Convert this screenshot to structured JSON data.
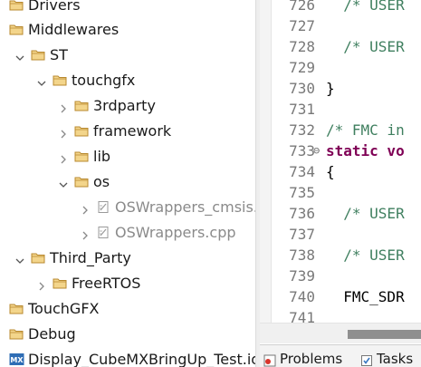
{
  "explorer": {
    "items": [
      {
        "label": "Drivers",
        "icon": "folder-icon",
        "expanded": null
      },
      {
        "label": "Middlewares",
        "icon": "folder-icon",
        "expanded": null
      },
      {
        "label": "ST",
        "icon": "folder-icon",
        "expanded": true
      },
      {
        "label": "touchgfx",
        "icon": "folder-icon",
        "expanded": true
      },
      {
        "label": "3rdparty",
        "icon": "folder-icon",
        "expanded": false
      },
      {
        "label": "framework",
        "icon": "folder-icon",
        "expanded": false
      },
      {
        "label": "lib",
        "icon": "folder-icon",
        "expanded": false
      },
      {
        "label": "os",
        "icon": "folder-icon",
        "expanded": true
      },
      {
        "label": "OSWrappers_cmsis.",
        "icon": "excluded-source-file-icon",
        "expanded": false
      },
      {
        "label": "OSWrappers.cpp",
        "icon": "excluded-source-file-icon",
        "expanded": false
      },
      {
        "label": "Third_Party",
        "icon": "folder-icon",
        "expanded": true
      },
      {
        "label": "FreeRTOS",
        "icon": "folder-icon",
        "expanded": false
      },
      {
        "label": "TouchGFX",
        "icon": "folder-icon",
        "expanded": null
      },
      {
        "label": "Debug",
        "icon": "folder-icon",
        "expanded": null
      },
      {
        "label": "Display_CubeMXBringUp_Test.io",
        "icon": "mx-file-icon",
        "expanded": null
      }
    ]
  },
  "editor": {
    "lines": [
      {
        "num": "726",
        "text": "  /* USER",
        "style": "comment",
        "fold": ""
      },
      {
        "num": "727",
        "text": "",
        "style": "plain",
        "fold": ""
      },
      {
        "num": "728",
        "text": "  /* USER",
        "style": "comment",
        "fold": ""
      },
      {
        "num": "729",
        "text": "",
        "style": "plain",
        "fold": ""
      },
      {
        "num": "730",
        "text": "}",
        "style": "plain",
        "fold": ""
      },
      {
        "num": "731",
        "text": "",
        "style": "plain",
        "fold": ""
      },
      {
        "num": "732",
        "text": "/* FMC in",
        "style": "comment",
        "fold": ""
      },
      {
        "num": "733",
        "text": "static vo",
        "style": "keyword",
        "fold": "⊖"
      },
      {
        "num": "734",
        "text": "{",
        "style": "plain",
        "fold": ""
      },
      {
        "num": "735",
        "text": "",
        "style": "plain",
        "fold": ""
      },
      {
        "num": "736",
        "text": "  /* USER",
        "style": "comment",
        "fold": ""
      },
      {
        "num": "737",
        "text": "",
        "style": "plain",
        "fold": ""
      },
      {
        "num": "738",
        "text": "  /* USER",
        "style": "comment",
        "fold": ""
      },
      {
        "num": "739",
        "text": "",
        "style": "plain",
        "fold": ""
      },
      {
        "num": "740",
        "text": "  FMC_SDR",
        "style": "plain",
        "fold": ""
      },
      {
        "num": "741",
        "text": "",
        "style": "plain",
        "fold": ""
      }
    ]
  },
  "bottom_tabs": [
    {
      "label": "Problems",
      "icon": "problems-icon"
    },
    {
      "label": "Tasks",
      "icon": "tasks-icon"
    }
  ],
  "colors": {
    "folder_fill": "#f3d58b",
    "folder_stroke": "#b8892f",
    "comment": "#3f7f5f",
    "keyword": "#7f0055",
    "mx_badge": "#2f6db5"
  }
}
